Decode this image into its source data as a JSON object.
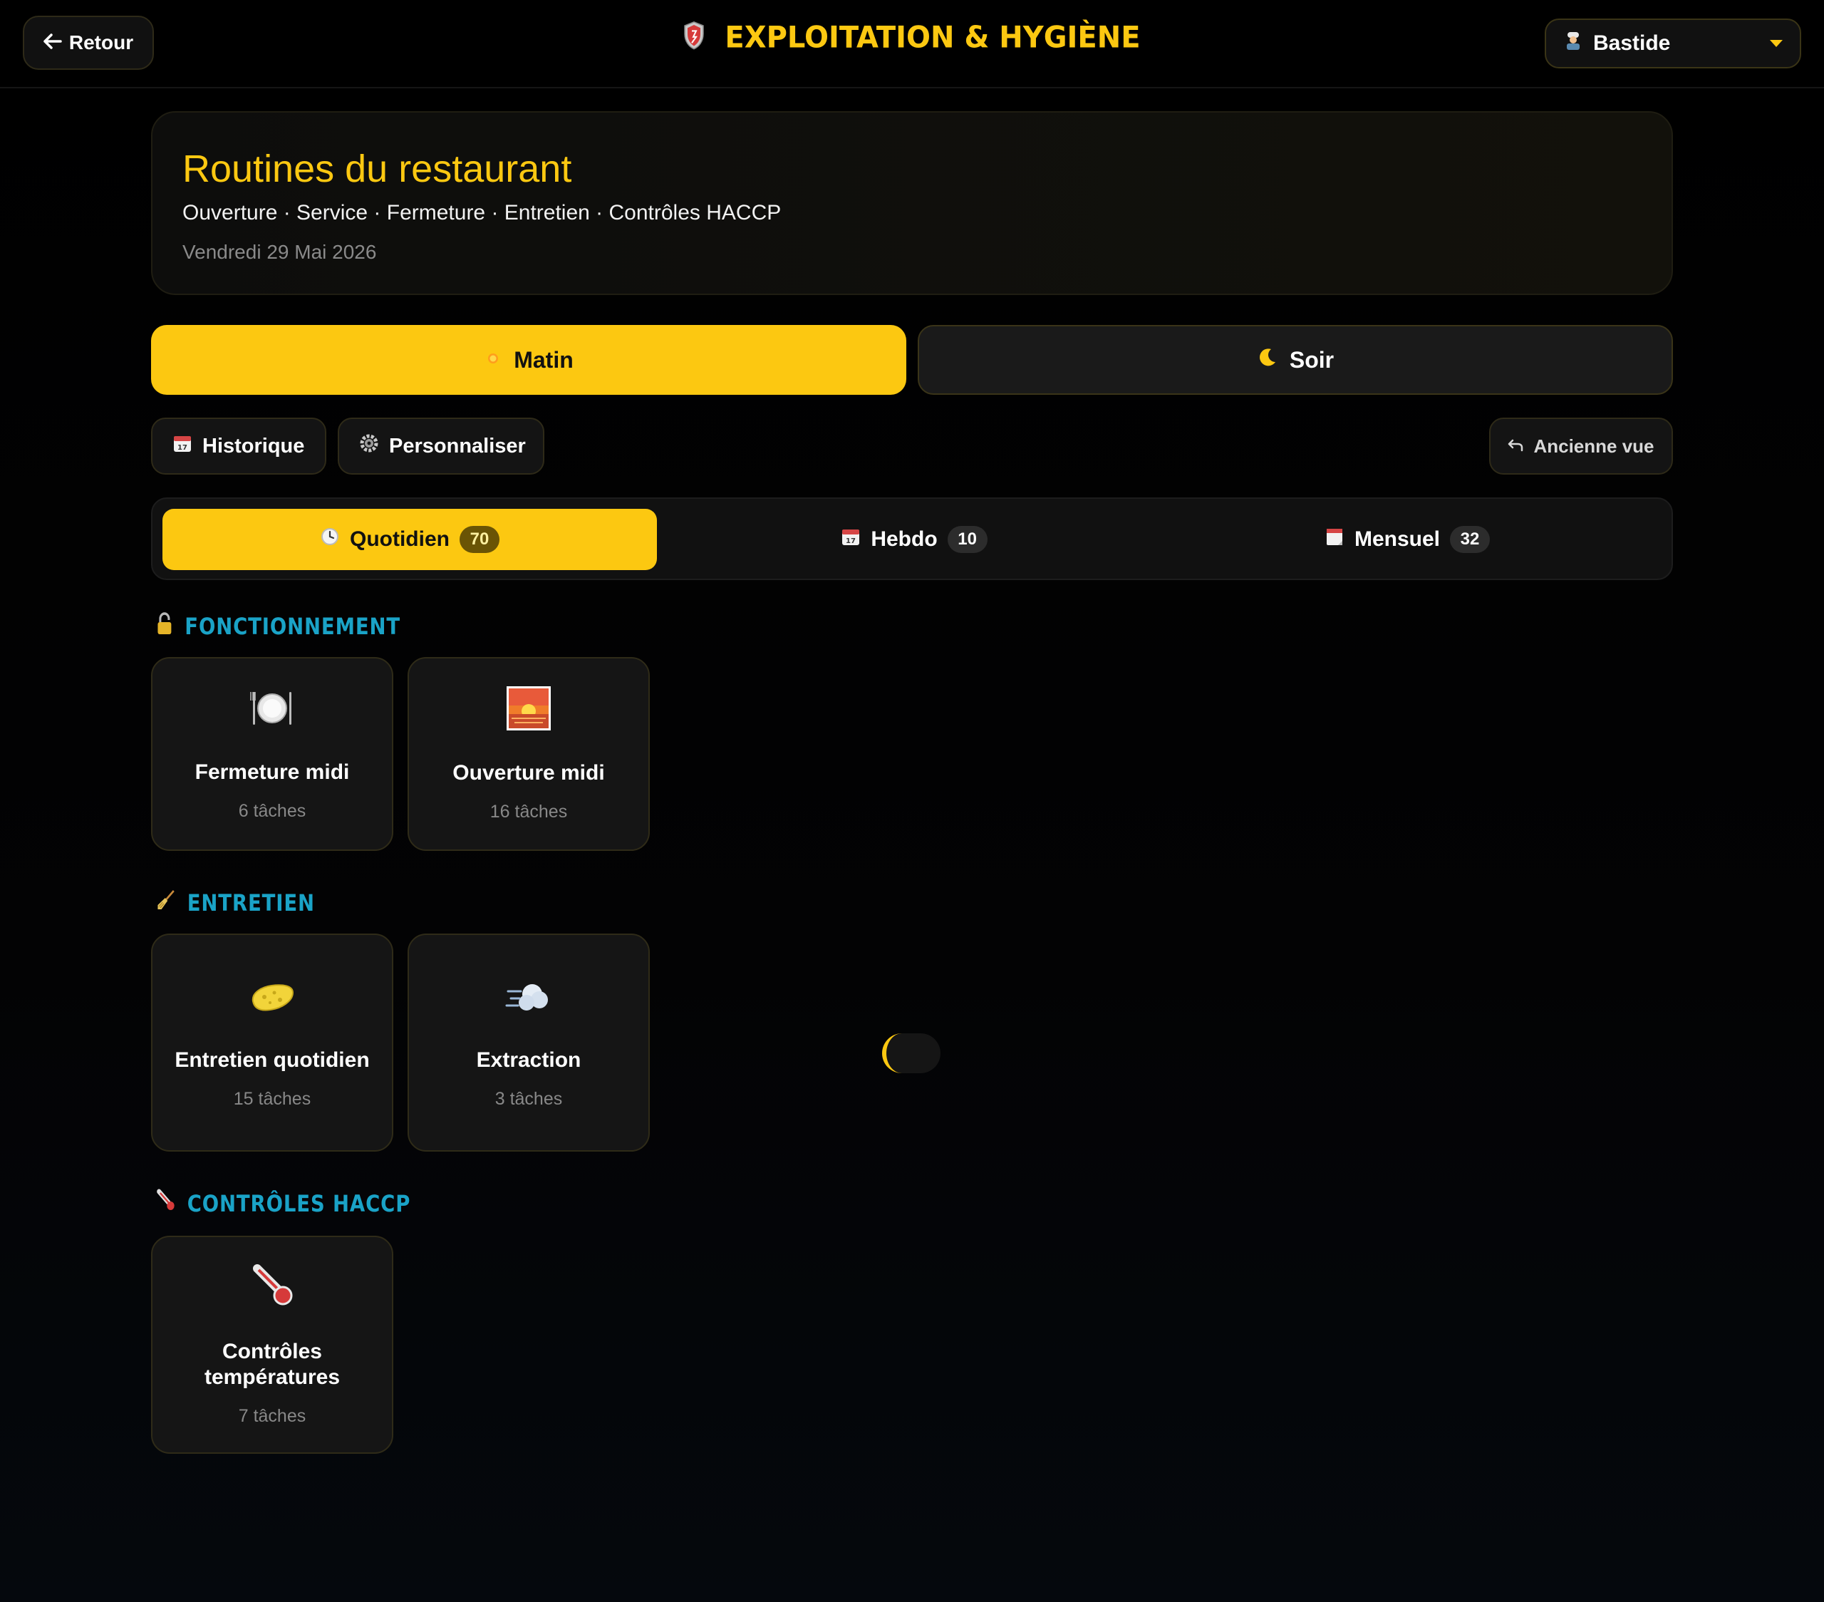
{
  "topbar": {
    "back_label": "Retour",
    "brand_title": "EXPLOITATION & HYGIÈNE",
    "site_selected": "Bastide"
  },
  "header": {
    "title": "Routines du restaurant",
    "subtitle": "Ouverture · Service · Fermeture · Entretien · Contrôles HACCP",
    "date": "Vendredi 29 Mai 2026"
  },
  "shifts": [
    {
      "label": "Matin",
      "icon": "sun-icon",
      "active": true
    },
    {
      "label": "Soir",
      "icon": "moon-icon",
      "active": false
    }
  ],
  "tools": {
    "history_label": "Historique",
    "customize_label": "Personnaliser",
    "old_view_label": "Ancienne vue"
  },
  "frequency_tabs": [
    {
      "label": "Quotidien",
      "count": "70",
      "icon": "clock-icon",
      "active": true
    },
    {
      "label": "Hebdo",
      "count": "10",
      "icon": "calendar-icon",
      "active": false
    },
    {
      "label": "Mensuel",
      "count": "32",
      "icon": "monthly-calendar-icon",
      "active": false
    }
  ],
  "sections": [
    {
      "title": "FONCTIONNEMENT",
      "icon": "lock-icon",
      "cards": [
        {
          "name": "Fermeture midi",
          "count": "6 tâches",
          "icon": "plate-icon"
        },
        {
          "name": "Ouverture midi",
          "count": "16 tâches",
          "icon": "sunrise-icon"
        }
      ]
    },
    {
      "title": "ENTRETIEN",
      "icon": "broom-icon",
      "cards": [
        {
          "name": "Entretien quotidien",
          "count": "15 tâches",
          "icon": "sponge-icon"
        },
        {
          "name": "Extraction",
          "count": "3 tâches",
          "icon": "wind-icon"
        }
      ]
    },
    {
      "title": "CONTRÔLES HACCP",
      "icon": "thermometer-icon",
      "cards": [
        {
          "name": "Contrôles températures",
          "count": "7 tâches",
          "icon": "thermometer-icon"
        }
      ]
    }
  ],
  "colors": {
    "accent": "#fcc811",
    "section_title": "#1aa3c7",
    "card_bg": "#151515",
    "page_bg": "#000000"
  }
}
